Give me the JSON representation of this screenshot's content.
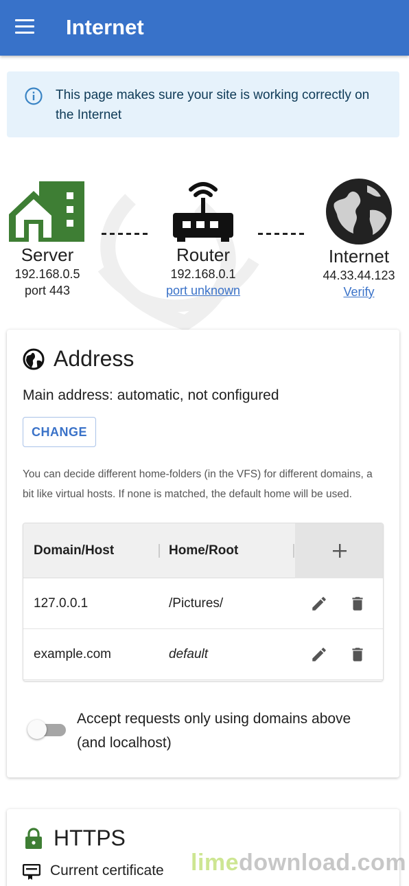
{
  "appbar": {
    "title": "Internet"
  },
  "info": {
    "text": "This page makes sure your site is working correctly on the Internet"
  },
  "network": {
    "server": {
      "name": "Server",
      "ip": "192.168.0.5",
      "port": "port 443"
    },
    "router": {
      "name": "Router",
      "ip": "192.168.0.1",
      "port_link": "port unknown"
    },
    "internet": {
      "name": "Internet",
      "ip": "44.33.44.123",
      "verify_link": "Verify"
    }
  },
  "address_card": {
    "title": "Address",
    "main_address": "Main address: automatic, not configured",
    "change_label": "CHANGE",
    "description": "You can decide different home-folders (in the VFS) for different domains, a bit like virtual hosts. If none is matched, the default home will be used.",
    "table": {
      "columns": [
        "Domain/Host",
        "Home/Root"
      ],
      "rows": [
        {
          "domain": "127.0.0.1",
          "root": "/Pictures/"
        },
        {
          "domain": "example.com",
          "root": "default"
        }
      ]
    },
    "toggle_label": "Accept requests only using domains above (and localhost)",
    "toggle_on": false
  },
  "https_card": {
    "title": "HTTPS",
    "current_certificate": "Current certificate"
  },
  "watermark": {
    "part1": "lime",
    "part2": "download.com"
  },
  "colors": {
    "primary": "#3872c9",
    "info_bg": "#e6f2fb",
    "server_green": "#3e7e34",
    "link": "#3a72c8"
  }
}
